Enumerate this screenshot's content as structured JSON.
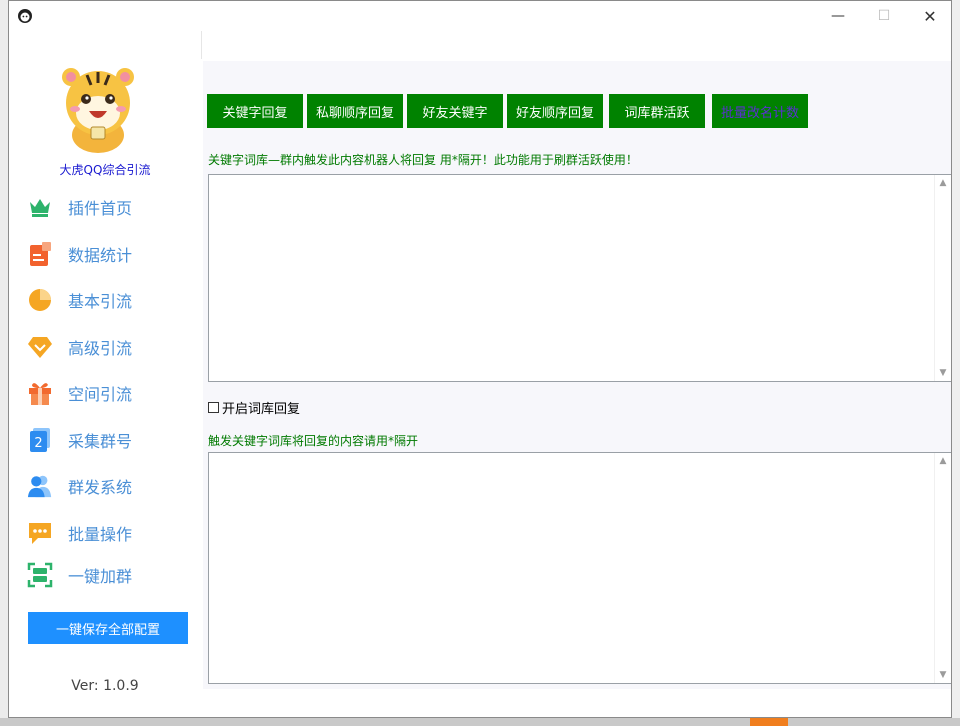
{
  "window": {
    "controls": {
      "minimize": "—",
      "maximize": "☐",
      "close": "✕"
    }
  },
  "sidebar": {
    "brand": "大虎QQ综合引流",
    "items": [
      {
        "label": "插件首页",
        "icon": "crown-icon",
        "color": "#2db36b"
      },
      {
        "label": "数据统计",
        "icon": "document-chart-icon",
        "color": "#f2622e"
      },
      {
        "label": "基本引流",
        "icon": "pie-chart-icon",
        "color": "#f5a623"
      },
      {
        "label": "高级引流",
        "icon": "diamond-icon",
        "color": "#f5a623"
      },
      {
        "label": "空间引流",
        "icon": "gift-icon",
        "color": "#f26a2e"
      },
      {
        "label": "采集群号",
        "icon": "number-badge-icon",
        "color": "#2d8cf0"
      },
      {
        "label": "群发系统",
        "icon": "users-icon",
        "color": "#2d8cf0"
      },
      {
        "label": "批量操作",
        "icon": "chat-bubble-icon",
        "color": "#f5a623"
      },
      {
        "label": "一键加群",
        "icon": "scan-icon",
        "color": "#2db36b"
      }
    ],
    "save_all_label": "一键保存全部配置",
    "version": "Ver:  1.0.9"
  },
  "main": {
    "tabs": [
      {
        "label": "关键字回复"
      },
      {
        "label": "私聊顺序回复"
      },
      {
        "label": "好友关键字"
      },
      {
        "label": "好友顺序回复"
      },
      {
        "label": "词库群活跃"
      },
      {
        "label": "批量改名计数",
        "active": true
      }
    ],
    "note_top": "关键字词库—群内触发此内容机器人将回复 用*隔开！此功能用于刷群活跃使用！",
    "keyword_textarea_value": "",
    "checkbox_label": "开启词库回复",
    "checkbox_checked": false,
    "note_bottom": "触发关键字词库将回复的内容请用*隔开",
    "reply_textarea_value": ""
  },
  "colors": {
    "tab_bg": "#008200",
    "nav_text": "#4a8fd6",
    "save_button_bg": "#1e90ff",
    "note_text": "#007a00",
    "brand_text": "#1a1ad0"
  }
}
